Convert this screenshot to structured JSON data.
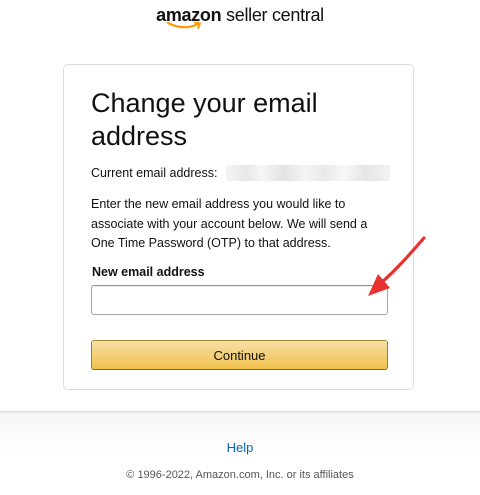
{
  "header": {
    "logo_brand": "amazon",
    "logo_product": " seller central"
  },
  "form": {
    "title": "Change your email address",
    "current_email_label": "Current email address:",
    "instructions": "Enter the new email address you would like to associate with your account below. We will send a One Time Password (OTP) to that address.",
    "new_email_label": "New email address",
    "new_email_value": "",
    "continue_label": "Continue"
  },
  "footer": {
    "help_label": "Help",
    "copyright": "© 1996-2022, Amazon.com, Inc. or its affiliates"
  },
  "colors": {
    "button_top": "#f7dfa5",
    "button_bottom": "#f0c14b",
    "link": "#0066c0",
    "annotation_arrow": "#e8322f",
    "logo_smile": "#f90"
  },
  "icons": [
    "amazon-smile-logo",
    "red-annotation-arrow"
  ]
}
